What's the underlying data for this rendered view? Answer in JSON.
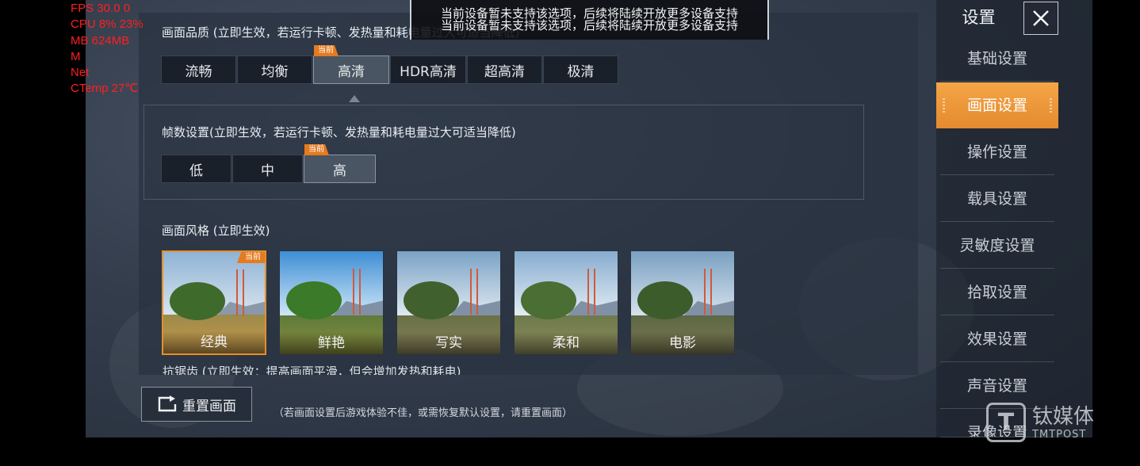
{
  "toast": {
    "line1": "当前设备暂未支持该选项，后续将陆续开放更多设备支持",
    "line2": "当前设备暂未支持该选项，后续将陆续开放更多设备支持"
  },
  "perf_overlay": {
    "lines": [
      "FPS  30.0   0",
      "CPU  8%    23%",
      "MB   624MB",
      "M",
      "Net",
      "CTemp  27℃"
    ]
  },
  "quality": {
    "title": "画面品质 (立即生效，若运行卡顿、发热量和耗电量过大可适当降低)",
    "options": [
      "流畅",
      "均衡",
      "高清",
      "HDR高清",
      "超高清",
      "极清"
    ],
    "current_index": 2,
    "current_badge": "当前"
  },
  "fps": {
    "title": "帧数设置(立即生效，若运行卡顿、发热量和耗电量过大可适当降低)",
    "options": [
      "低",
      "中",
      "高"
    ],
    "current_index": 2,
    "current_badge": "当前"
  },
  "style": {
    "title": "画面风格 (立即生效)",
    "options": [
      "经典",
      "鲜艳",
      "写实",
      "柔和",
      "电影"
    ],
    "current_index": 0,
    "current_badge": "当前"
  },
  "antialias_title_cut": "抗锯齿 (立即生效：提高画面平滑，但会增加发热和耗电)",
  "reset": {
    "label": "重置画面",
    "note": "（若画面设置后游戏体验不佳，或需恢复默认设置，请重置画面）"
  },
  "sidebar": {
    "title": "设置",
    "items": [
      "基础设置",
      "画面设置",
      "操作设置",
      "载具设置",
      "灵敏度设置",
      "拾取设置",
      "效果设置",
      "声音设置",
      "录像设置"
    ],
    "active_index": 1
  },
  "watermark": {
    "logo_glyph": "T",
    "cn": "钛媒体",
    "en": "TMTPOST"
  },
  "colors": {
    "accent": "#e58f2a",
    "badge": "#e57a1f",
    "overlay_text": "#ff1f1f"
  }
}
